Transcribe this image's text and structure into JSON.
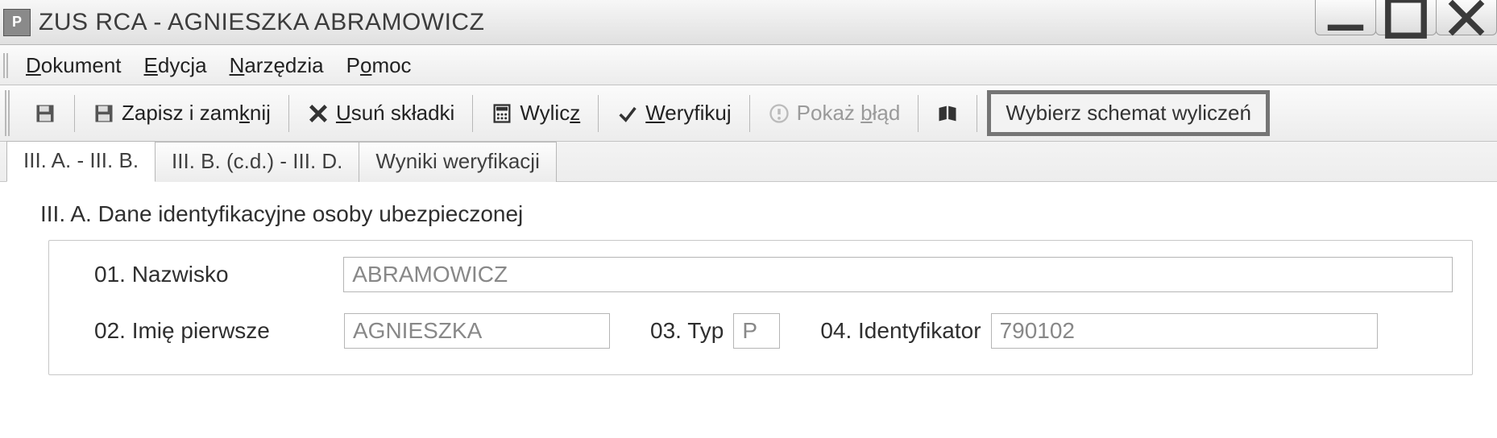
{
  "window": {
    "title": "ZUS RCA - AGNIESZKA ABRAMOWICZ"
  },
  "menu": {
    "dokument": "Dokument",
    "edycja": "Edycja",
    "narzedzia": "Narzędzia",
    "pomoc": "Pomoc"
  },
  "toolbar": {
    "zapisz_zamknij": "Zapisz i zamknij",
    "usun_skladki": "Usuń składki",
    "wylicz": "Wylicz",
    "weryfikuj": "Weryfikuj",
    "pokaz_blad": "Pokaż błąd",
    "wybierz_schemat": "Wybierz schemat wyliczeń"
  },
  "tabs": {
    "t1": "III. A. - III. B.",
    "t2": "III. B. (c.d.) - III. D.",
    "t3": "Wyniki weryfikacji"
  },
  "section": {
    "title": "III. A. Dane identyfikacyjne osoby ubezpieczonej",
    "f01_label": "01. Nazwisko",
    "f01_value": "ABRAMOWICZ",
    "f02_label": "02. Imię pierwsze",
    "f02_value": "AGNIESZKA",
    "f03_label": "03. Typ",
    "f03_value": "P",
    "f04_label": "04. Identyfikator",
    "f04_value": "790102"
  }
}
